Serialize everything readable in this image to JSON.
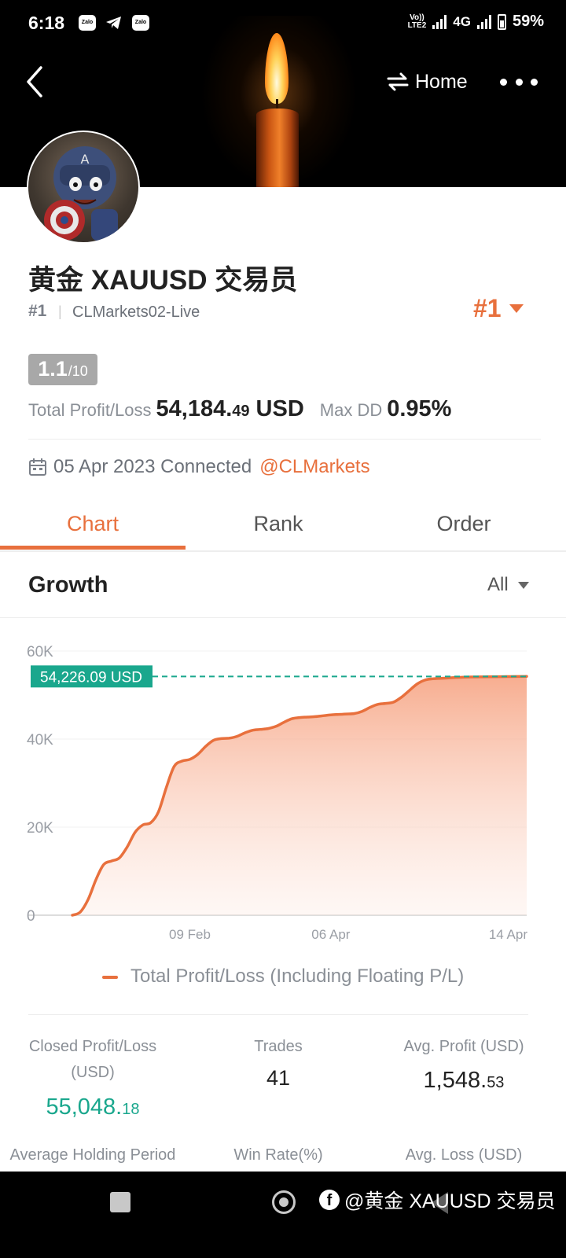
{
  "status_bar": {
    "time": "6:18",
    "apps": [
      "Zalo",
      "Zalo"
    ],
    "network_label_top": "Vo))",
    "network_label_bottom": "LTE2",
    "network_type": "4G",
    "battery": "59%"
  },
  "toolbar": {
    "home_label": "Home"
  },
  "profile": {
    "name": "黄金 XAUUSD 交易员",
    "rank_small": "#1",
    "server": "CLMarkets02-Live",
    "rank_dropdown": "#1",
    "score_main": "1.1",
    "score_sub": "/10",
    "total_pl_label": "Total Profit/Loss",
    "total_pl_int": "54,184.",
    "total_pl_dec": "49",
    "total_pl_currency": "USD",
    "max_dd_label": "Max DD",
    "max_dd_value": "0.95%",
    "connected_text": "05 Apr 2023 Connected",
    "broker_link": "@CLMarkets"
  },
  "tabs": [
    {
      "label": "Chart",
      "active": true
    },
    {
      "label": "Rank",
      "active": false
    },
    {
      "label": "Order",
      "active": false
    }
  ],
  "growth": {
    "title": "Growth",
    "range": "All"
  },
  "chart_data": {
    "type": "area",
    "title": "",
    "xlabel": "",
    "ylabel": "",
    "ylim": [
      0,
      60000
    ],
    "y_ticks": [
      0,
      20000,
      40000,
      60000
    ],
    "y_tick_labels": [
      "0",
      "20K",
      "40K",
      "60K"
    ],
    "x_tick_labels": [
      "09 Feb",
      "06 Apr",
      "14 Apr"
    ],
    "x_tick_index": [
      15,
      33,
      58
    ],
    "current_value": 54226.09,
    "current_value_label": "54,226.09 USD",
    "grid": true,
    "legend_position": "bottom",
    "series": [
      {
        "name": "Total Profit/Loss (Including Floating P/L)",
        "color": "#e8703d",
        "values": [
          0,
          700,
          3500,
          8000,
          11500,
          12300,
          13000,
          15500,
          18800,
          20500,
          21000,
          23500,
          29000,
          33800,
          35000,
          35400,
          36500,
          38300,
          39700,
          40100,
          40200,
          40600,
          41400,
          42000,
          42200,
          42400,
          42900,
          43800,
          44600,
          44900,
          45000,
          45100,
          45300,
          45500,
          45600,
          45700,
          45800,
          46300,
          47200,
          47900,
          48100,
          48400,
          49500,
          51000,
          52500,
          53400,
          53700,
          53800,
          53900,
          54000,
          54050,
          54100,
          54120,
          54140,
          54160,
          54180,
          54200,
          54215,
          54226
        ]
      }
    ]
  },
  "legend": {
    "label": "Total Profit/Loss (Including Floating P/L)"
  },
  "stats": {
    "closed_pl_label_1": "Closed Profit/Loss",
    "closed_pl_label_2": "(USD)",
    "closed_pl_int": "55,048.",
    "closed_pl_dec": "18",
    "trades_label": "Trades",
    "trades_value": "41",
    "avg_profit_label": "Avg. Profit (USD)",
    "avg_profit_int": "1,548.",
    "avg_profit_dec": "53",
    "avg_holding_label": "Average Holding Period",
    "win_rate_label": "Win Rate(%)",
    "avg_loss_label": "Avg. Loss (USD)"
  },
  "watermark": {
    "fb_glyph": "f",
    "text": "@黄金 XAUUSD 交易员"
  },
  "colors": {
    "accent": "#e8703d",
    "teal": "#1aa78d",
    "badge_gray": "#a8a8a8"
  }
}
